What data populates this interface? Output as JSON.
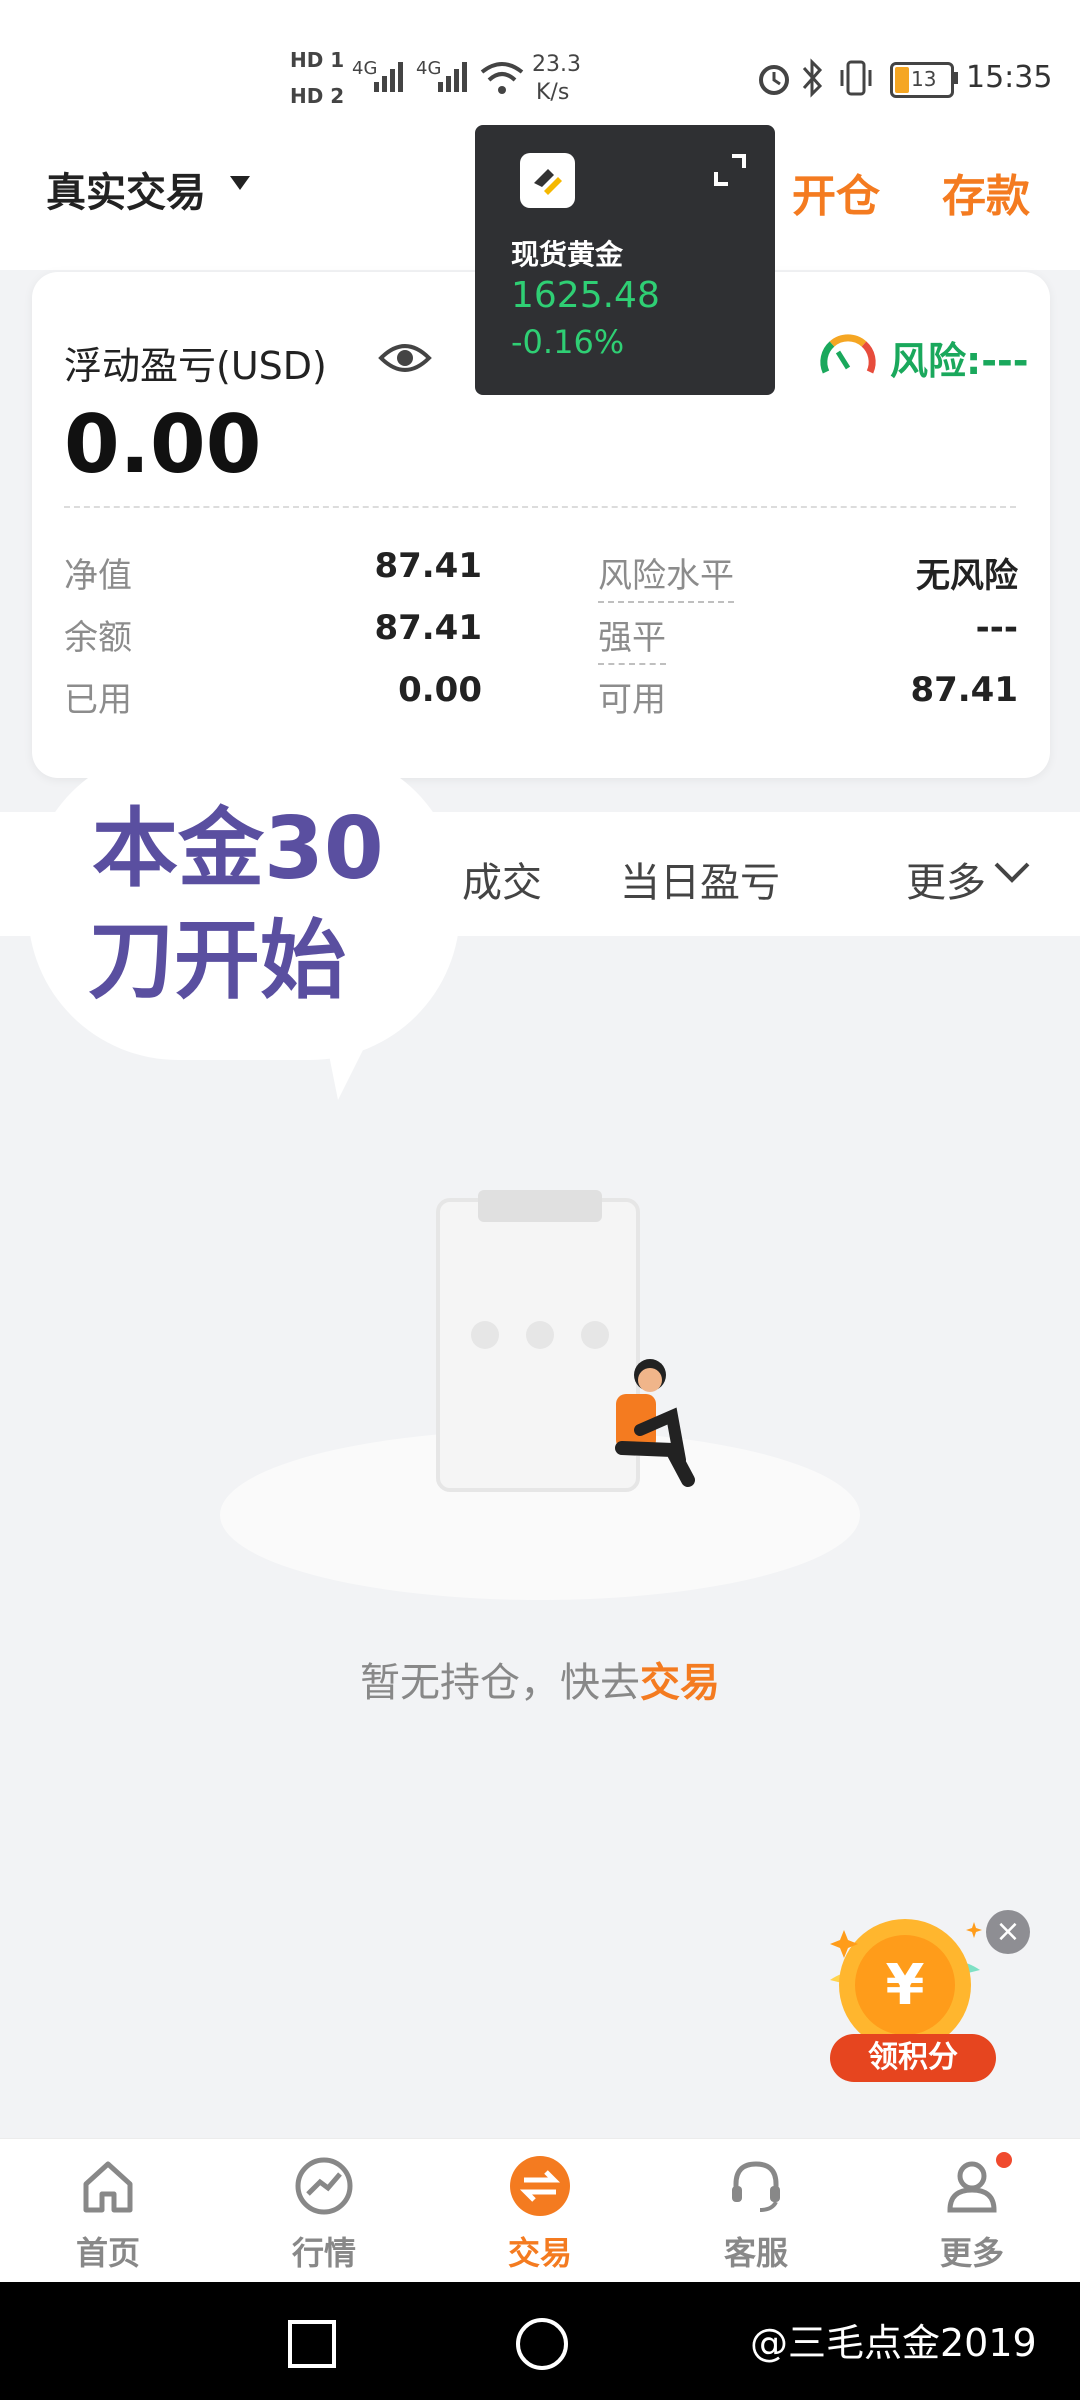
{
  "status_bar": {
    "hd1": "HD 1",
    "hd2": "HD 2",
    "net1": "4G",
    "net2": "4G",
    "speed": "23.3",
    "speed_unit": "K/s",
    "battery": "13",
    "time": "15:35"
  },
  "header": {
    "account": "真实交易",
    "open_position": "开仓",
    "deposit": "存款"
  },
  "widget": {
    "name": "现货黄金",
    "price": "1625.48",
    "change": "-0.16%"
  },
  "summary": {
    "pl_label": "浮动盈亏(USD)",
    "pl_value": "0.00",
    "risk_label": "风险:---",
    "rows": [
      {
        "k1": "净值",
        "v1": "87.41",
        "k2": "风险水平",
        "v2": "无风险"
      },
      {
        "k1": "余额",
        "v1": "87.41",
        "k2": "强平",
        "v2": "---"
      },
      {
        "k1": "已用",
        "v1": "0.00",
        "k2": "可用",
        "v2": "87.41"
      }
    ]
  },
  "tabs": {
    "t1": "成交",
    "t2": "当日盈亏",
    "more": "更多"
  },
  "sticker": {
    "line1": "本金30",
    "line2": "刀开始"
  },
  "empty": {
    "text": "暂无持仓，快去",
    "link": "交易"
  },
  "promo": {
    "label": "领积分",
    "close": "×"
  },
  "nav": {
    "items": [
      {
        "label": "首页",
        "icon": "home-icon"
      },
      {
        "label": "行情",
        "icon": "chart-icon"
      },
      {
        "label": "交易",
        "icon": "swap-icon"
      },
      {
        "label": "客服",
        "icon": "headset-icon"
      },
      {
        "label": "更多",
        "icon": "user-icon"
      }
    ]
  },
  "watermark": "@三毛点金2019",
  "colors": {
    "accent": "#f47b20",
    "green": "#2fcf74",
    "risk_green": "#1aa85c",
    "sticker_purple": "#5a4fa0"
  }
}
